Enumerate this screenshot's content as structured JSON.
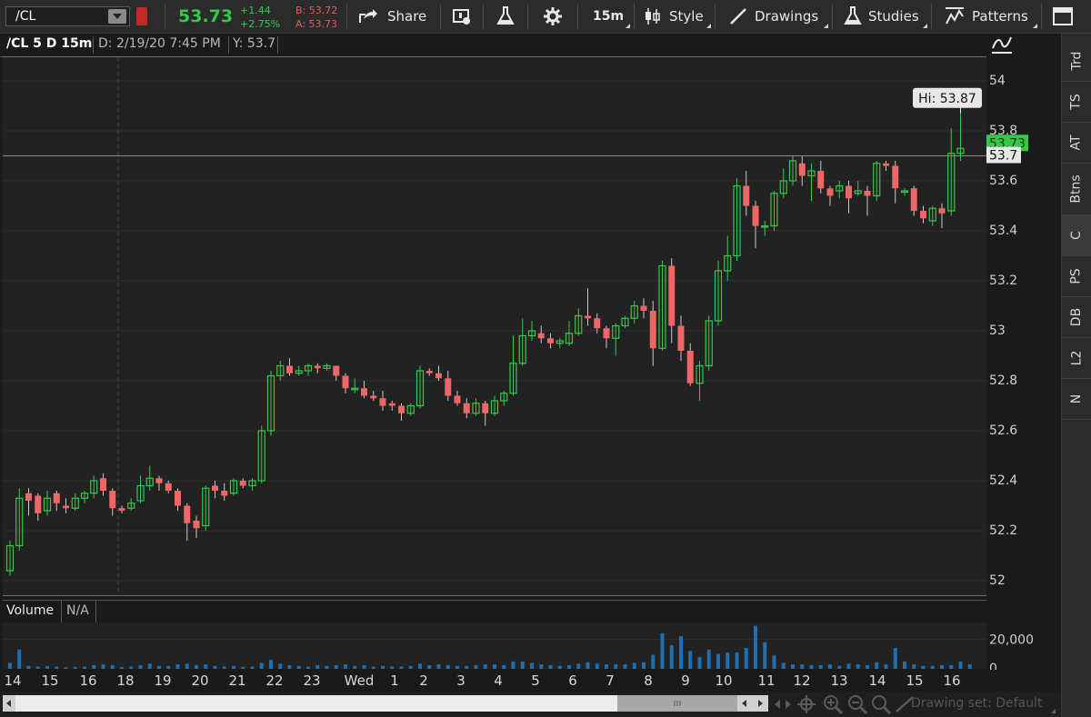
{
  "toolbar": {
    "symbol": "/CL",
    "last": "53.73",
    "change": "+1.44",
    "change_pct": "+2.75%",
    "bid": "B: 53.72",
    "ask": "A: 53.73",
    "share_label": "Share",
    "timeframe_label": "15m",
    "style_label": "Style",
    "drawings_label": "Drawings",
    "studies_label": "Studies",
    "patterns_label": "Patterns"
  },
  "chart_header": {
    "symbol_label": "/CL 5 D 15m",
    "date_label": "D: 2/19/20 7:45 PM",
    "y_label": "Y: 53.7"
  },
  "volume_header": {
    "label": "Volume",
    "value": "N/A"
  },
  "badges": {
    "hi": "Hi: 53.87",
    "last_badge": "53.73",
    "cursor_badge": "53.7"
  },
  "drawing_set_label": "Drawing set: Default",
  "side_tabs": [
    "Trd",
    "TS",
    "AT",
    "Btns",
    "C",
    "PS",
    "DB",
    "L2",
    "N"
  ],
  "colors": {
    "up": "#35c94a",
    "down": "#f06565",
    "volume": "#1f6fb0",
    "accent_green": "#35c94a"
  },
  "chart_data": {
    "type": "candlestick",
    "price_axis": {
      "ticks": [
        52,
        52.2,
        52.4,
        52.6,
        52.8,
        53,
        53.2,
        53.4,
        53.6,
        53.8,
        54
      ],
      "range": [
        51.95,
        54.1
      ]
    },
    "volume_axis": {
      "ticks": [
        "20,000",
        "0"
      ],
      "range": [
        0,
        30000
      ]
    },
    "x_tick_labels": [
      "14",
      "15",
      "16",
      "18",
      "19",
      "20",
      "21",
      "22",
      "23",
      "Wed",
      "1",
      "2",
      "3",
      "4",
      "5",
      "6",
      "7",
      "8",
      "9",
      "10",
      "11",
      "12",
      "13",
      "14",
      "15",
      "16"
    ],
    "crosshair_y": 53.7,
    "high": 53.87,
    "last": 53.73,
    "candles": [
      [
        52.04,
        52.14,
        52.02,
        52.16
      ],
      [
        52.14,
        52.33,
        52.12,
        52.37
      ],
      [
        52.35,
        52.32,
        52.26,
        52.37
      ],
      [
        52.34,
        52.27,
        52.24,
        52.35
      ],
      [
        52.28,
        52.33,
        52.26,
        52.36
      ],
      [
        52.35,
        52.31,
        52.28,
        52.36
      ],
      [
        52.3,
        52.29,
        52.27,
        52.33
      ],
      [
        52.29,
        52.33,
        52.28,
        52.35
      ],
      [
        52.33,
        52.35,
        52.31,
        52.36
      ],
      [
        52.35,
        52.4,
        52.33,
        52.42
      ],
      [
        52.41,
        52.36,
        52.34,
        52.43
      ],
      [
        52.36,
        52.29,
        52.26,
        52.37
      ],
      [
        52.29,
        52.28,
        52.27,
        52.3
      ],
      [
        52.29,
        52.31,
        52.28,
        52.33
      ],
      [
        52.32,
        52.38,
        52.31,
        52.42
      ],
      [
        52.38,
        52.41,
        52.36,
        52.46
      ],
      [
        52.41,
        52.39,
        52.36,
        52.42
      ],
      [
        52.39,
        52.36,
        52.35,
        52.4
      ],
      [
        52.36,
        52.3,
        52.28,
        52.37
      ],
      [
        52.3,
        52.23,
        52.16,
        52.31
      ],
      [
        52.24,
        52.21,
        52.17,
        52.26
      ],
      [
        52.22,
        52.37,
        52.2,
        52.38
      ],
      [
        52.38,
        52.36,
        52.33,
        52.4
      ],
      [
        52.36,
        52.34,
        52.32,
        52.39
      ],
      [
        52.35,
        52.4,
        52.34,
        52.41
      ],
      [
        52.4,
        52.38,
        52.37,
        52.41
      ],
      [
        52.38,
        52.4,
        52.36,
        52.41
      ],
      [
        52.4,
        52.6,
        52.39,
        52.62
      ],
      [
        52.6,
        52.82,
        52.58,
        52.84
      ],
      [
        52.82,
        52.86,
        52.8,
        52.88
      ],
      [
        52.86,
        52.83,
        52.82,
        52.89
      ],
      [
        52.83,
        52.84,
        52.82,
        52.86
      ],
      [
        52.84,
        52.86,
        52.82,
        52.87
      ],
      [
        52.86,
        52.85,
        52.83,
        52.87
      ],
      [
        52.85,
        52.86,
        52.84,
        52.87
      ],
      [
        52.86,
        52.82,
        52.8,
        52.86
      ],
      [
        52.82,
        52.77,
        52.75,
        52.83
      ],
      [
        52.77,
        52.77,
        52.75,
        52.81
      ],
      [
        52.77,
        52.74,
        52.73,
        52.8
      ],
      [
        52.74,
        52.73,
        52.72,
        52.76
      ],
      [
        52.73,
        52.7,
        52.68,
        52.76
      ],
      [
        52.71,
        52.7,
        52.68,
        52.72
      ],
      [
        52.7,
        52.67,
        52.64,
        52.71
      ],
      [
        52.67,
        52.7,
        52.66,
        52.71
      ],
      [
        52.7,
        52.84,
        52.69,
        52.86
      ],
      [
        52.84,
        52.83,
        52.82,
        52.85
      ],
      [
        52.83,
        52.81,
        52.8,
        52.86
      ],
      [
        52.81,
        52.74,
        52.72,
        52.84
      ],
      [
        52.74,
        52.71,
        52.7,
        52.76
      ],
      [
        52.71,
        52.67,
        52.65,
        52.73
      ],
      [
        52.67,
        52.71,
        52.66,
        52.73
      ],
      [
        52.71,
        52.67,
        52.62,
        52.72
      ],
      [
        52.67,
        52.72,
        52.66,
        52.74
      ],
      [
        52.72,
        52.75,
        52.7,
        52.76
      ],
      [
        52.75,
        52.87,
        52.74,
        52.98
      ],
      [
        52.87,
        52.98,
        52.86,
        53.05
      ],
      [
        52.98,
        53.0,
        52.96,
        53.04
      ],
      [
        52.99,
        52.97,
        52.95,
        53.02
      ],
      [
        52.97,
        52.95,
        52.93,
        52.99
      ],
      [
        52.95,
        52.96,
        52.93,
        52.97
      ],
      [
        52.95,
        52.99,
        52.94,
        53.04
      ],
      [
        52.99,
        53.06,
        52.98,
        53.09
      ],
      [
        53.06,
        53.05,
        53.02,
        53.17
      ],
      [
        53.05,
        53.01,
        52.99,
        53.07
      ],
      [
        53.01,
        52.97,
        52.93,
        53.02
      ],
      [
        52.97,
        53.02,
        52.9,
        53.03
      ],
      [
        53.02,
        53.05,
        53.01,
        53.06
      ],
      [
        53.05,
        53.1,
        53.03,
        53.12
      ],
      [
        53.1,
        53.08,
        53.05,
        53.13
      ],
      [
        53.08,
        52.93,
        52.86,
        53.12
      ],
      [
        52.93,
        53.26,
        52.92,
        53.28
      ],
      [
        53.26,
        53.02,
        52.95,
        53.29
      ],
      [
        53.02,
        52.92,
        52.88,
        53.06
      ],
      [
        52.92,
        52.79,
        52.78,
        52.95
      ],
      [
        52.79,
        52.86,
        52.72,
        52.88
      ],
      [
        52.86,
        53.04,
        52.84,
        53.06
      ],
      [
        53.04,
        53.24,
        53.02,
        53.28
      ],
      [
        53.24,
        53.3,
        53.2,
        53.38
      ],
      [
        53.3,
        53.58,
        53.28,
        53.61
      ],
      [
        53.58,
        53.5,
        53.46,
        53.64
      ],
      [
        53.5,
        53.42,
        53.33,
        53.52
      ],
      [
        53.42,
        53.42,
        53.38,
        53.44
      ],
      [
        53.42,
        53.55,
        53.4,
        53.56
      ],
      [
        53.55,
        53.6,
        53.53,
        53.65
      ],
      [
        53.6,
        53.68,
        53.58,
        53.7
      ],
      [
        53.67,
        53.62,
        53.58,
        53.7
      ],
      [
        53.62,
        53.64,
        53.52,
        53.67
      ],
      [
        53.64,
        53.57,
        53.55,
        53.68
      ],
      [
        53.57,
        53.54,
        53.5,
        53.58
      ],
      [
        53.56,
        53.58,
        53.53,
        53.6
      ],
      [
        53.58,
        53.53,
        53.47,
        53.6
      ],
      [
        53.55,
        53.56,
        53.54,
        53.6
      ],
      [
        53.56,
        53.54,
        53.46,
        53.58
      ],
      [
        53.54,
        53.67,
        53.52,
        53.68
      ],
      [
        53.67,
        53.66,
        53.64,
        53.68
      ],
      [
        53.66,
        53.57,
        53.51,
        53.68
      ],
      [
        53.56,
        53.56,
        53.54,
        53.57
      ],
      [
        53.57,
        53.48,
        53.46,
        53.58
      ],
      [
        53.48,
        53.45,
        53.43,
        53.5
      ],
      [
        53.44,
        53.49,
        53.42,
        53.5
      ],
      [
        53.49,
        53.47,
        53.41,
        53.51
      ],
      [
        53.48,
        53.71,
        53.46,
        53.81
      ],
      [
        53.71,
        53.73,
        53.68,
        53.87
      ]
    ],
    "volume": [
      4000,
      13000,
      2000,
      1500,
      2000,
      1500,
      1000,
      1200,
      1500,
      2500,
      3000,
      2500,
      1200,
      1500,
      2500,
      3500,
      2000,
      2000,
      3000,
      3500,
      2500,
      3000,
      2000,
      1500,
      2000,
      1200,
      1500,
      4000,
      6000,
      3500,
      2500,
      2000,
      1500,
      2500,
      2000,
      2500,
      3000,
      2000,
      2500,
      1500,
      2000,
      1500,
      1500,
      2000,
      3500,
      2500,
      3000,
      2500,
      2000,
      2000,
      2500,
      3000,
      3000,
      2500,
      5000,
      5000,
      4000,
      3000,
      2500,
      2000,
      2500,
      3500,
      4500,
      3500,
      3000,
      3000,
      3000,
      4000,
      4500,
      9500,
      24000,
      16000,
      22000,
      12000,
      8000,
      13000,
      10000,
      11000,
      11000,
      14000,
      29000,
      18000,
      9000,
      4000,
      3000,
      3000,
      2500,
      2500,
      3000,
      2000,
      3500,
      3000,
      2500,
      4500,
      3000,
      14000,
      5000,
      3000,
      2000,
      2000,
      2500,
      2500,
      5000,
      3000
    ]
  }
}
